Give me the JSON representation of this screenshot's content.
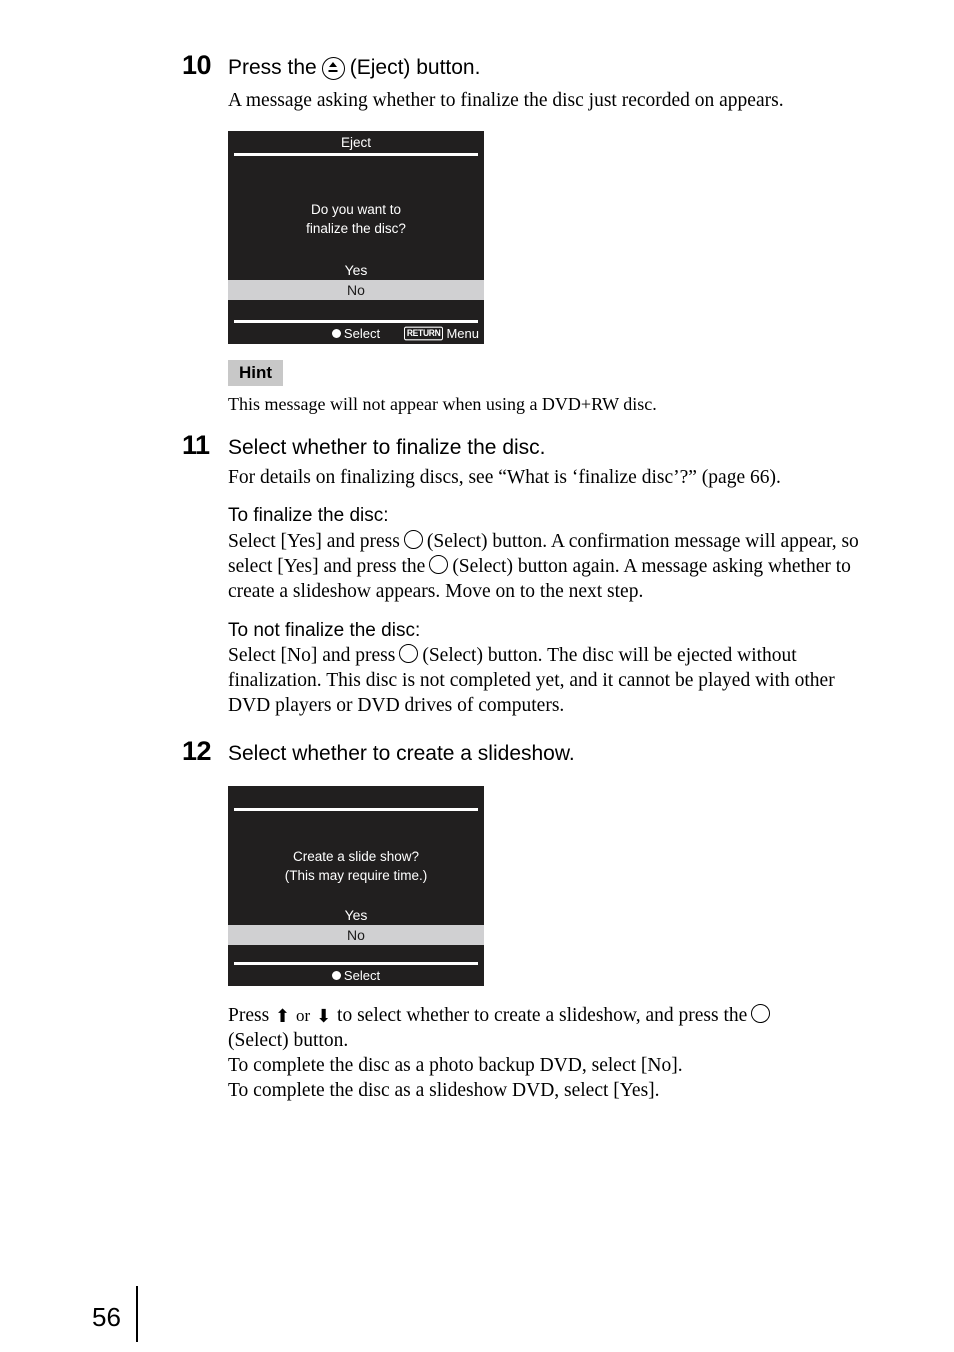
{
  "page": {
    "folio": "56"
  },
  "steps": [
    {
      "number": "10",
      "title_before": "Press the",
      "title_after": "(Eject) button.",
      "intro": "A message asking whether to finalize the disc just recorded on appears."
    },
    {
      "number": "11",
      "title": "Select whether to finalize the disc.",
      "intro": "For details on finalizing discs, see “What is ‘finalize disc’?” (page 66).",
      "sections": [
        {
          "heading": "To finalize the disc:",
          "body_1": "Select [Yes] and press",
          "body_2": "(Select) button. A confirmation message will appear, so select [Yes] and press the",
          "body_3": "(Select) button again. A message asking whether to create a slideshow appears. Move on to the next step."
        },
        {
          "heading": "To not finalize the disc:",
          "body_1": "Select [No] and press",
          "body_2": "(Select) button. The disc will be ejected without finalization. This disc is not completed yet, and it cannot be played with other DVD players or DVD drives of computers."
        }
      ]
    },
    {
      "number": "12",
      "title": "Select whether to create a slideshow.",
      "closing": {
        "line1_a": "Press",
        "line1_or": "or",
        "line1_b": "to select whether to create a slideshow, and press the",
        "line2": "(Select) button.",
        "line3": "To complete the disc as a photo backup DVD, select [No].",
        "line4": "To complete the disc as a slideshow DVD, select [Yes]."
      }
    }
  ],
  "hint": {
    "badge": "Hint",
    "text": "This message will not appear when using a DVD+RW disc."
  },
  "lcd_dialogs": [
    {
      "title": "Eject",
      "message_lines": [
        "Do you want to",
        "finalize the disc?"
      ],
      "options": [
        {
          "label": "Yes",
          "selected": false
        },
        {
          "label": "No",
          "selected": true
        }
      ],
      "footer": {
        "select_label": "Select",
        "return_badge": "RETURN",
        "menu_label": "Menu"
      }
    },
    {
      "title": "",
      "message_lines": [
        "Create a slide show?",
        "(This may require time.)"
      ],
      "options": [
        {
          "label": "Yes",
          "selected": false
        },
        {
          "label": "No",
          "selected": true
        }
      ],
      "footer": {
        "select_label": "Select",
        "return_badge": "",
        "menu_label": ""
      }
    }
  ],
  "icons": {
    "eject": "eject-icon",
    "select": "select-button-icon",
    "arrow_up": "⬆",
    "arrow_down": "⬇"
  },
  "colors": {
    "lcd_background": "#211f1f",
    "lcd_highlight": "#d0d0d2",
    "hint_badge_background": "#c8c8c8",
    "text": "#000000"
  }
}
